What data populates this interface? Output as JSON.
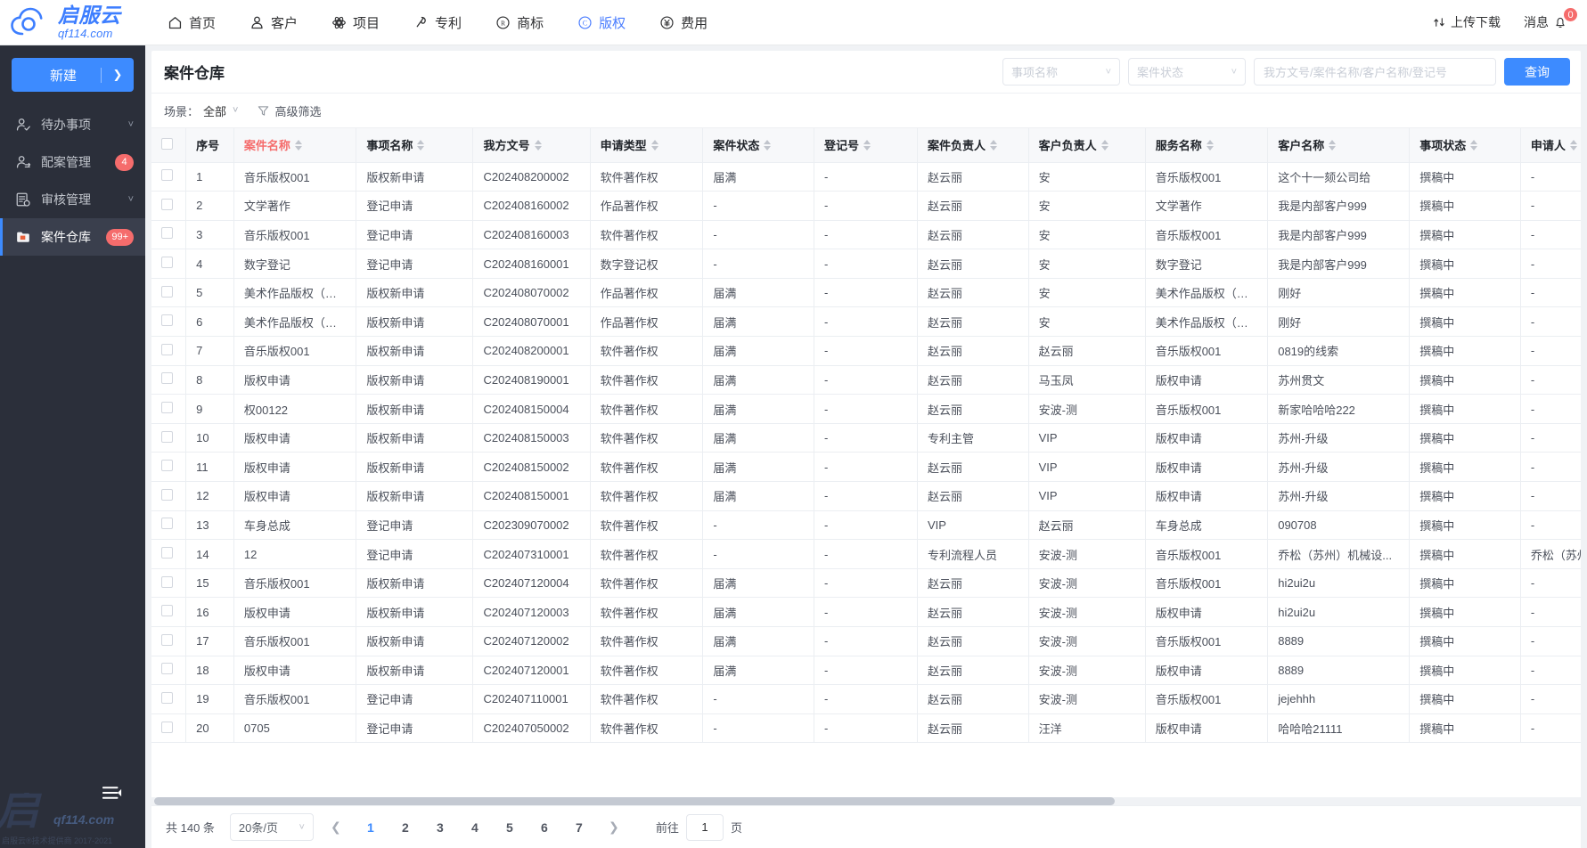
{
  "brand": {
    "cn": "启服云",
    "en": "qf114.com"
  },
  "topnav": [
    {
      "label": "首页",
      "icon": "home-icon",
      "active": false
    },
    {
      "label": "客户",
      "icon": "user-icon",
      "active": false
    },
    {
      "label": "项目",
      "icon": "atom-icon",
      "active": false
    },
    {
      "label": "专利",
      "icon": "patent-icon",
      "active": false
    },
    {
      "label": "商标",
      "icon": "registered-icon",
      "active": false
    },
    {
      "label": "版权",
      "icon": "copyright-icon",
      "active": true
    },
    {
      "label": "费用",
      "icon": "yen-icon",
      "active": false
    }
  ],
  "topright": {
    "upload_label": "上传下载",
    "upload_icon": "upload-download-icon",
    "message_label": "消息",
    "message_icon": "bell-icon",
    "message_count": "0"
  },
  "sidebar": {
    "new_button": "新建",
    "items": [
      {
        "label": "待办事项",
        "icon": "todo-user-icon",
        "trail": "chevron",
        "badge": "",
        "active": false
      },
      {
        "label": "配案管理",
        "icon": "assign-user-icon",
        "trail": "badge",
        "badge": "4",
        "active": false
      },
      {
        "label": "审核管理",
        "icon": "audit-icon",
        "trail": "chevron",
        "badge": "",
        "active": false
      },
      {
        "label": "案件仓库",
        "icon": "case-folder-icon",
        "trail": "badge",
        "badge": "99+",
        "active": true
      }
    ],
    "watermark_big": "启",
    "watermark_domain": "qf114.com",
    "watermark_sub": "启服云®技术提供商 2017-2021"
  },
  "page": {
    "title": "案件仓库",
    "filters": {
      "item_name_placeholder": "事项名称",
      "case_status_placeholder": "案件状态",
      "keyword_placeholder": "我方文号/案件名称/客户名称/登记号",
      "search_button": "查询"
    },
    "scene_label": "场景：",
    "scene_value": "全部",
    "advanced_filter": "高级筛选"
  },
  "table": {
    "columns": [
      {
        "key": "idx",
        "label": "序号",
        "sortable": false,
        "red": false
      },
      {
        "key": "name",
        "label": "案件名称",
        "sortable": true,
        "red": true
      },
      {
        "key": "item",
        "label": "事项名称",
        "sortable": true,
        "red": false
      },
      {
        "key": "docno",
        "label": "我方文号",
        "sortable": true,
        "red": false
      },
      {
        "key": "type",
        "label": "申请类型",
        "sortable": true,
        "red": false
      },
      {
        "key": "cstat",
        "label": "案件状态",
        "sortable": true,
        "red": false
      },
      {
        "key": "regno",
        "label": "登记号",
        "sortable": true,
        "red": false
      },
      {
        "key": "owner",
        "label": "案件负责人",
        "sortable": true,
        "red": false
      },
      {
        "key": "cowner",
        "label": "客户负责人",
        "sortable": true,
        "red": false
      },
      {
        "key": "svc",
        "label": "服务名称",
        "sortable": true,
        "red": false
      },
      {
        "key": "cust",
        "label": "客户名称",
        "sortable": true,
        "red": false
      },
      {
        "key": "istat",
        "label": "事项状态",
        "sortable": true,
        "red": false
      },
      {
        "key": "appl",
        "label": "申请人",
        "sortable": true,
        "red": false
      }
    ],
    "rows": [
      {
        "idx": "1",
        "name": "音乐版权001",
        "item": "版权新申请",
        "docno": "C202408200002",
        "type": "软件著作权",
        "cstat": "届满",
        "regno": "-",
        "owner": "赵云丽",
        "cowner": "安",
        "svc": "音乐版权001",
        "cust": "这个十一颏公司给",
        "istat": "撰稿中",
        "appl": "-"
      },
      {
        "idx": "2",
        "name": "文学著作",
        "item": "登记申请",
        "docno": "C202408160002",
        "type": "作品著作权",
        "cstat": "-",
        "regno": "-",
        "owner": "赵云丽",
        "cowner": "安",
        "svc": "文学著作",
        "cust": "我是内部客户999",
        "istat": "撰稿中",
        "appl": "-"
      },
      {
        "idx": "3",
        "name": "音乐版权001",
        "item": "登记申请",
        "docno": "C202408160003",
        "type": "软件著作权",
        "cstat": "-",
        "regno": "-",
        "owner": "赵云丽",
        "cowner": "安",
        "svc": "音乐版权001",
        "cust": "我是内部客户999",
        "istat": "撰稿中",
        "appl": "-"
      },
      {
        "idx": "4",
        "name": "数字登记",
        "item": "登记申请",
        "docno": "C202408160001",
        "type": "数字登记权",
        "cstat": "-",
        "regno": "-",
        "owner": "赵云丽",
        "cowner": "安",
        "svc": "数字登记",
        "cust": "我是内部客户999",
        "istat": "撰稿中",
        "appl": "-"
      },
      {
        "idx": "5",
        "name": "美术作品版权（中国）",
        "item": "版权新申请",
        "docno": "C202408070002",
        "type": "作品著作权",
        "cstat": "届满",
        "regno": "-",
        "owner": "赵云丽",
        "cowner": "安",
        "svc": "美术作品版权（中国）",
        "cust": "刚好",
        "istat": "撰稿中",
        "appl": "-"
      },
      {
        "idx": "6",
        "name": "美术作品版权（省级）",
        "item": "版权新申请",
        "docno": "C202408070001",
        "type": "作品著作权",
        "cstat": "届满",
        "regno": "-",
        "owner": "赵云丽",
        "cowner": "安",
        "svc": "美术作品版权（省级）",
        "cust": "刚好",
        "istat": "撰稿中",
        "appl": "-"
      },
      {
        "idx": "7",
        "name": "音乐版权001",
        "item": "版权新申请",
        "docno": "C202408200001",
        "type": "软件著作权",
        "cstat": "届满",
        "regno": "-",
        "owner": "赵云丽",
        "cowner": "赵云丽",
        "svc": "音乐版权001",
        "cust": "0819的线索",
        "istat": "撰稿中",
        "appl": "-"
      },
      {
        "idx": "8",
        "name": "版权申请",
        "item": "版权新申请",
        "docno": "C202408190001",
        "type": "软件著作权",
        "cstat": "届满",
        "regno": "-",
        "owner": "赵云丽",
        "cowner": "马玉凤",
        "svc": "版权申请",
        "cust": "苏州贯文",
        "istat": "撰稿中",
        "appl": "-"
      },
      {
        "idx": "9",
        "name": "权00122",
        "item": "版权新申请",
        "docno": "C202408150004",
        "type": "软件著作权",
        "cstat": "届满",
        "regno": "-",
        "owner": "赵云丽",
        "cowner": "安波-测",
        "svc": "音乐版权001",
        "cust": "新家哈哈哈222",
        "istat": "撰稿中",
        "appl": "-"
      },
      {
        "idx": "10",
        "name": "版权申请",
        "item": "版权新申请",
        "docno": "C202408150003",
        "type": "软件著作权",
        "cstat": "届满",
        "regno": "-",
        "owner": "专利主管",
        "cowner": "VIP",
        "svc": "版权申请",
        "cust": "苏州-升级",
        "istat": "撰稿中",
        "appl": "-"
      },
      {
        "idx": "11",
        "name": "版权申请",
        "item": "版权新申请",
        "docno": "C202408150002",
        "type": "软件著作权",
        "cstat": "届满",
        "regno": "-",
        "owner": "赵云丽",
        "cowner": "VIP",
        "svc": "版权申请",
        "cust": "苏州-升级",
        "istat": "撰稿中",
        "appl": "-"
      },
      {
        "idx": "12",
        "name": "版权申请",
        "item": "版权新申请",
        "docno": "C202408150001",
        "type": "软件著作权",
        "cstat": "届满",
        "regno": "-",
        "owner": "赵云丽",
        "cowner": "VIP",
        "svc": "版权申请",
        "cust": "苏州-升级",
        "istat": "撰稿中",
        "appl": "-"
      },
      {
        "idx": "13",
        "name": "车身总成",
        "item": "登记申请",
        "docno": "C202309070002",
        "type": "软件著作权",
        "cstat": "-",
        "regno": "-",
        "owner": "VIP",
        "cowner": "赵云丽",
        "svc": "车身总成",
        "cust": "090708",
        "istat": "撰稿中",
        "appl": "-"
      },
      {
        "idx": "14",
        "name": "12",
        "item": "登记申请",
        "docno": "C202407310001",
        "type": "软件著作权",
        "cstat": "-",
        "regno": "-",
        "owner": "专利流程人员",
        "cowner": "安波-测",
        "svc": "音乐版权001",
        "cust": "乔松（苏州）机械设...",
        "istat": "撰稿中",
        "appl": "乔松（苏州）"
      },
      {
        "idx": "15",
        "name": "音乐版权001",
        "item": "版权新申请",
        "docno": "C202407120004",
        "type": "软件著作权",
        "cstat": "届满",
        "regno": "-",
        "owner": "赵云丽",
        "cowner": "安波-测",
        "svc": "音乐版权001",
        "cust": "hi2ui2u",
        "istat": "撰稿中",
        "appl": "-"
      },
      {
        "idx": "16",
        "name": "版权申请",
        "item": "版权新申请",
        "docno": "C202407120003",
        "type": "软件著作权",
        "cstat": "届满",
        "regno": "-",
        "owner": "赵云丽",
        "cowner": "安波-测",
        "svc": "版权申请",
        "cust": "hi2ui2u",
        "istat": "撰稿中",
        "appl": "-"
      },
      {
        "idx": "17",
        "name": "音乐版权001",
        "item": "版权新申请",
        "docno": "C202407120002",
        "type": "软件著作权",
        "cstat": "届满",
        "regno": "-",
        "owner": "赵云丽",
        "cowner": "安波-测",
        "svc": "音乐版权001",
        "cust": "8889",
        "istat": "撰稿中",
        "appl": "-"
      },
      {
        "idx": "18",
        "name": "版权申请",
        "item": "版权新申请",
        "docno": "C202407120001",
        "type": "软件著作权",
        "cstat": "届满",
        "regno": "-",
        "owner": "赵云丽",
        "cowner": "安波-测",
        "svc": "版权申请",
        "cust": "8889",
        "istat": "撰稿中",
        "appl": "-"
      },
      {
        "idx": "19",
        "name": "音乐版权001",
        "item": "登记申请",
        "docno": "C202407110001",
        "type": "软件著作权",
        "cstat": "-",
        "regno": "-",
        "owner": "赵云丽",
        "cowner": "安波-测",
        "svc": "音乐版权001",
        "cust": "jejehhh",
        "istat": "撰稿中",
        "appl": "-"
      },
      {
        "idx": "20",
        "name": "0705",
        "item": "登记申请",
        "docno": "C202407050002",
        "type": "软件著作权",
        "cstat": "-",
        "regno": "-",
        "owner": "赵云丽",
        "cowner": "汪洋",
        "svc": "版权申请",
        "cust": "哈哈哈21111",
        "istat": "撰稿中",
        "appl": "-"
      }
    ]
  },
  "pager": {
    "total_label": "共 140 条",
    "page_size": "20条/页",
    "prev_icon": "chevron-left-icon",
    "next_icon": "chevron-right-icon",
    "pages": [
      "1",
      "2",
      "3",
      "4",
      "5",
      "6",
      "7"
    ],
    "current_page": "1",
    "goto_label": "前往",
    "goto_value": "1",
    "goto_unit": "页"
  },
  "colors": {
    "accent": "#3d8bff",
    "link": "#5a8bf0",
    "danger": "#f56c6c",
    "sidebar_bg": "#2b2f3a",
    "header_bg": "#f7f8fa"
  }
}
